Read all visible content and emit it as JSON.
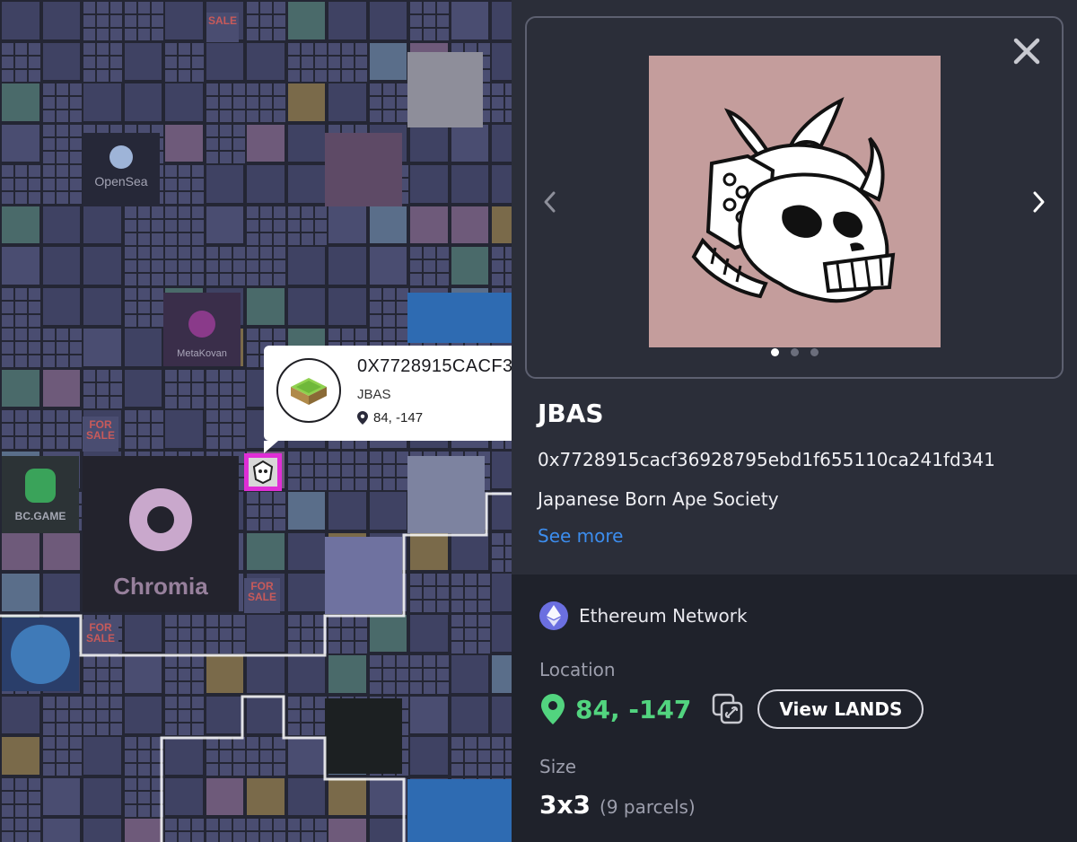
{
  "map": {
    "tooltip": {
      "address": "0X7728915CACF3",
      "name": "JBAS",
      "location": "84, -147"
    },
    "logos": {
      "opensea": "OpenSea",
      "metakovan": "MetaKovan",
      "bcgame": "BC.GAME",
      "chromia": "Chromia",
      "for_sale": "FOR SALE",
      "sale": "SALE"
    }
  },
  "panel": {
    "carousel": {
      "total_images": 3,
      "active_index": 0
    },
    "title": "JBAS",
    "address": "0x7728915cacf36928795ebd1f655110ca241fd341",
    "description": "Japanese Born Ape Society",
    "see_more": "See more",
    "network": "Ethereum Network",
    "location_heading": "Location",
    "location_value": "84, -147",
    "view_lands_button": "View LANDS",
    "size_heading": "Size",
    "size_value": "3x3",
    "size_parcels": "(9 parcels)"
  },
  "colors": {
    "accent_link": "#3c8dee",
    "location_green": "#52d47f",
    "selected_parcel": "#e02ed6",
    "map_background": "#242634",
    "panel_background": "#2b2e39"
  }
}
